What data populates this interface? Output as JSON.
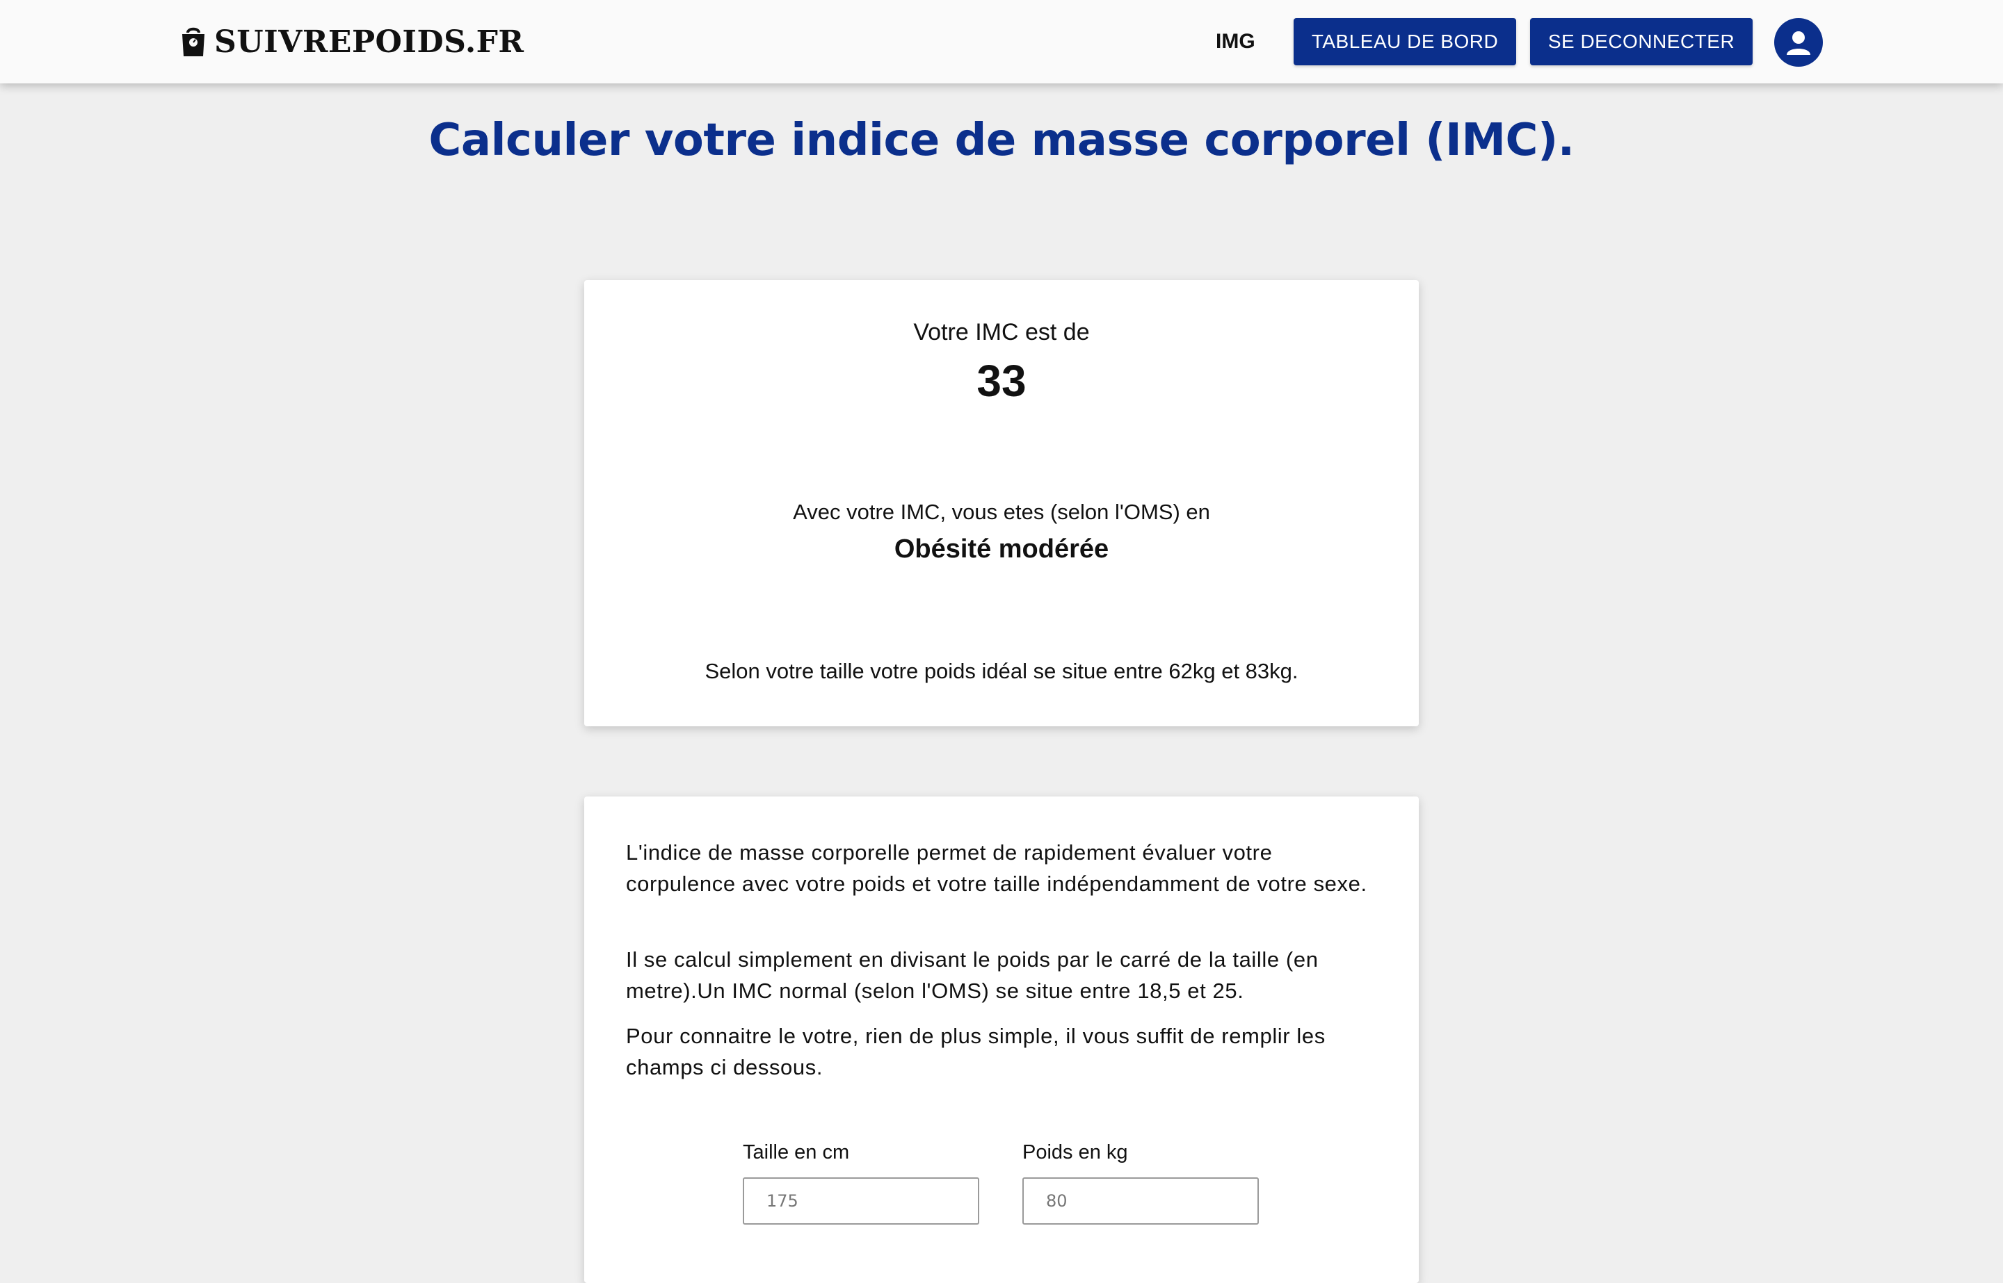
{
  "navbar": {
    "brand": "SUIVREPOIDS.FR",
    "brand_icon": "scale-bag-icon",
    "link_img": "IMG",
    "dashboard_label": "TABLEAU DE BORD",
    "logout_label": "SE DECONNECTER",
    "avatar_icon": "user-icon",
    "accent_color": "#0b2f8c"
  },
  "page": {
    "title": "Calculer votre indice de masse corporel (IMC)."
  },
  "result": {
    "intro": "Votre IMC est de",
    "value": "33",
    "oms_text": "Avec votre IMC, vous etes (selon l'OMS) en",
    "category": "Obésité modérée",
    "ideal_text": "Selon votre taille votre poids idéal se situe entre 62kg et 83kg."
  },
  "info": {
    "paragraph1": "L'indice de masse corporelle permet de rapidement évaluer votre corpulence avec votre poids et votre taille indépendamment de votre sexe.",
    "paragraph2": "Il se calcul simplement en divisant le poids par le carré de la taille (en metre).Un IMC normal (selon l'OMS) se situe entre 18,5 et 25.",
    "paragraph3": "Pour connaitre le votre, rien de plus simple, il vous suffit de remplir les champs ci dessous."
  },
  "form": {
    "taille_label": "Taille en cm",
    "taille_placeholder": "175",
    "poids_label": "Poids en kg",
    "poids_placeholder": "80"
  }
}
